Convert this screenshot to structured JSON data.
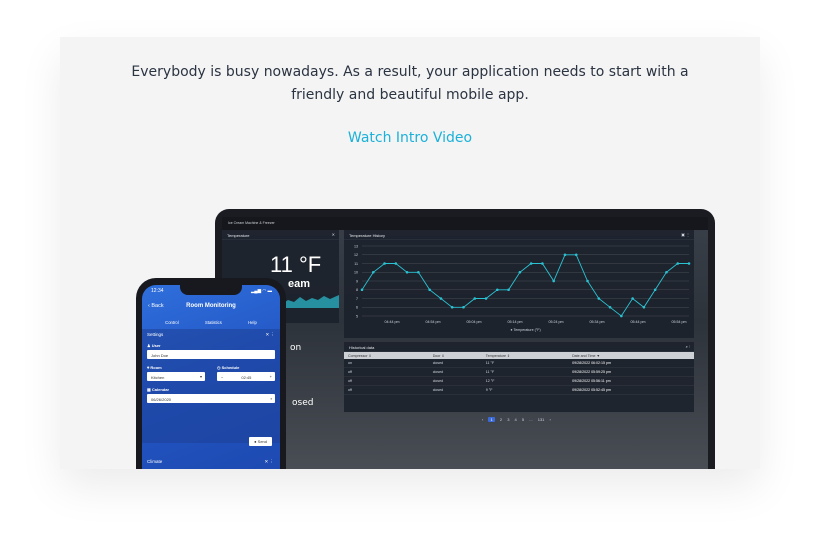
{
  "intro": {
    "text": "Everybody is busy nowadays. As a result, your application needs to start with a friendly and beautiful mobile app.",
    "video_link": "Watch Intro Video",
    "accent_color": "#1bb1d8"
  },
  "laptop": {
    "app_title": "Ice Cream Machine & Freezer",
    "temperature_panel": {
      "title": "Temperature",
      "value": "11 °F",
      "partial_label": "eam",
      "partial_status_1": "on",
      "partial_status_2": "osed"
    },
    "history_panel": {
      "title": "Temperature History",
      "legend": "Temperature (°F)"
    },
    "historical_data": {
      "title": "Historical data",
      "columns": [
        "Compressor ⇕",
        "Door ⇕",
        "Temperature ⇕",
        "Date and Time ▼"
      ],
      "rows": [
        [
          "on",
          "closed",
          "11 °F",
          "09/28/2022 06:02:15 pm"
        ],
        [
          "off",
          "closed",
          "11 °F",
          "09/28/2022 05:59:25 pm"
        ],
        [
          "off",
          "closed",
          "12 °F",
          "09/28/2022 05:56:11 pm"
        ],
        [
          "off",
          "closed",
          "9 °F",
          "09/28/2022 05:52:45 pm"
        ]
      ]
    },
    "pagination": {
      "prev": "‹",
      "pages": [
        "1",
        "2",
        "3",
        "4",
        "5",
        "...",
        "131"
      ],
      "next": "›"
    }
  },
  "chart_data": {
    "type": "line",
    "title": "Temperature History",
    "legend": [
      "Temperature (°F)"
    ],
    "x_tick_labels": [
      "04:44 pm",
      "04:54 pm",
      "05:04 pm",
      "05:14 pm",
      "05:24 pm",
      "05:34 pm",
      "05:44 pm",
      "05:54 pm"
    ],
    "y_tick_labels": [
      "5",
      "6",
      "7",
      "8",
      "9",
      "10",
      "11",
      "12",
      "13"
    ],
    "ylim": [
      5,
      13
    ],
    "series": [
      {
        "name": "Temperature (°F)",
        "values": [
          8,
          10,
          11,
          11,
          10,
          10,
          8,
          7,
          6,
          6,
          7,
          7,
          8,
          8,
          10,
          11,
          11,
          9,
          12,
          12,
          9,
          7,
          6,
          5,
          7,
          6,
          8,
          10,
          11,
          11
        ]
      }
    ]
  },
  "phone": {
    "time": "12:34",
    "status_icons": "▂▄▆ ◠ ▬",
    "back_label": "‹ Back",
    "title": "Room Monitoring",
    "tabs": [
      "Control",
      "Statistics",
      "Help"
    ],
    "settings_title": "Settings",
    "user_label": "User",
    "user_value": "John Doe",
    "room_label": "Room",
    "room_value": "Kitchen",
    "schedule_label": "Schedule",
    "schedule_value": "02:45",
    "calendar_label": "Calendar",
    "calendar_value": "06/26/2020",
    "send_label": "Send",
    "climate_title": "Climate"
  }
}
